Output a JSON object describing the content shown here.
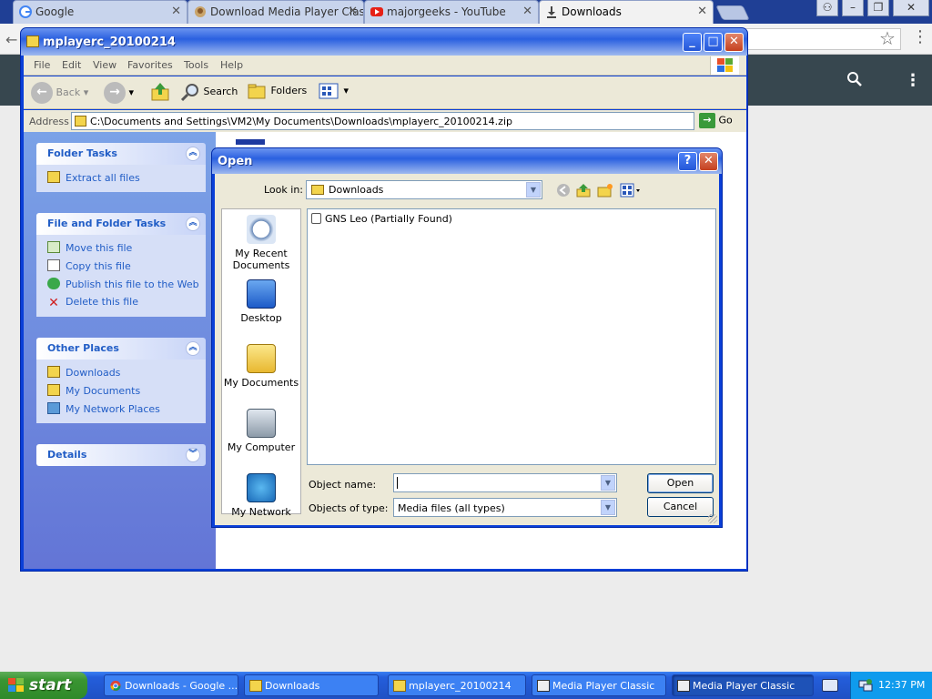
{
  "chrome": {
    "tabs": [
      {
        "label": "Google",
        "icon": "google-icon"
      },
      {
        "label": "Download Media Player Classic",
        "icon": "majorgeeks-icon"
      },
      {
        "label": "majorgeeks - YouTube",
        "icon": "youtube-icon"
      },
      {
        "label": "Downloads",
        "icon": "download-icon",
        "active": true
      }
    ]
  },
  "explorer": {
    "title": "mplayerc_20100214",
    "menu": [
      "File",
      "Edit",
      "View",
      "Favorites",
      "Tools",
      "Help"
    ],
    "toolbar": {
      "back": "Back",
      "search": "Search",
      "folders": "Folders"
    },
    "address_label": "Address",
    "address_value": "C:\\Documents and Settings\\VM2\\My Documents\\Downloads\\mplayerc_20100214.zip",
    "go_label": "Go",
    "panels": {
      "folder_tasks": {
        "title": "Folder Tasks",
        "items": [
          "Extract all files"
        ]
      },
      "file_folder_tasks": {
        "title": "File and Folder Tasks",
        "items": [
          "Move this file",
          "Copy this file",
          "Publish this file to the Web",
          "Delete this file"
        ]
      },
      "other_places": {
        "title": "Other Places",
        "items": [
          "Downloads",
          "My Documents",
          "My Network Places"
        ]
      },
      "details": {
        "title": "Details"
      }
    }
  },
  "dialog": {
    "title": "Open",
    "help": "?",
    "look_in_label": "Look in:",
    "look_in_value": "Downloads",
    "places": [
      "My Recent Documents",
      "Desktop",
      "My Documents",
      "My Computer",
      "My Network"
    ],
    "files": [
      "GNS Leo (Partially Found)"
    ],
    "object_name_label": "Object name:",
    "object_name_value": "",
    "objects_type_label": "Objects of type:",
    "objects_type_value": "Media files (all types)",
    "open_button": "Open",
    "cancel_button": "Cancel"
  },
  "taskbar": {
    "start": "start",
    "tasks": [
      {
        "label": "Downloads - Google ...",
        "icon": "chrome-icon"
      },
      {
        "label": "Downloads",
        "icon": "folder-icon"
      },
      {
        "label": "mplayerc_20100214",
        "icon": "zip-folder-icon"
      },
      {
        "label": "Media Player Classic",
        "icon": "mpc-icon"
      },
      {
        "label": "Media Player Classic",
        "icon": "mpc-icon",
        "active": true
      }
    ],
    "clock": "12:37 PM"
  }
}
